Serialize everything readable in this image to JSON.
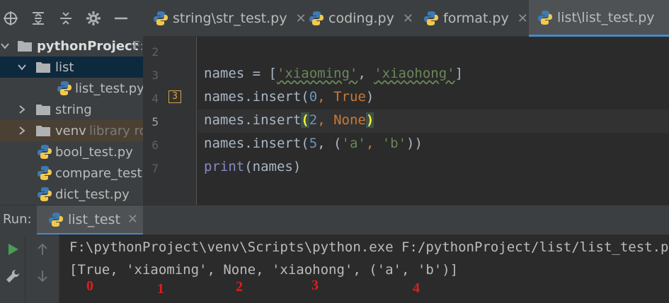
{
  "colors": {
    "accent": "#4a88c7",
    "annotation_red": "#e01e1e",
    "string_green": "#6a8759",
    "keyword_orange": "#cc7832"
  },
  "project_panel": {
    "toolbar_icons": [
      "locate-icon",
      "expand-all-icon",
      "collapse-all-icon",
      "gear-icon",
      "minimize-icon"
    ],
    "tree": [
      {
        "label": "pythonProject",
        "suffix": "F:",
        "kind": "folder",
        "expanded": true
      },
      {
        "label": "list",
        "kind": "folder",
        "expanded": true,
        "selected": true
      },
      {
        "label": "list_test.py",
        "kind": "python-file"
      },
      {
        "label": "string",
        "kind": "folder",
        "expanded": false
      },
      {
        "label": "venv",
        "suffix": "library ro",
        "kind": "folder",
        "expanded": false
      },
      {
        "label": "bool_test.py",
        "kind": "python-file"
      },
      {
        "label": "compare_test.p",
        "kind": "python-file"
      },
      {
        "label": "dict_test.py",
        "kind": "python-file"
      }
    ]
  },
  "editor_tabs": [
    {
      "label": "string\\str_test.py"
    },
    {
      "label": "coding.py"
    },
    {
      "label": "format.py"
    },
    {
      "label": "list\\list_test.py",
      "active": true
    }
  ],
  "editor": {
    "line_numbers": [
      "2",
      "3",
      "4",
      "5",
      "6",
      "7"
    ],
    "current_line": "5",
    "gutter_badge": "3",
    "code": {
      "l3": {
        "a": "names = [",
        "s1": "'xiaoming'",
        "b": ", ",
        "s2": "'xiaohong'",
        "c": "]"
      },
      "l4": {
        "a": "names.insert(",
        "n": "0",
        "b": ", ",
        "k": "True",
        "c": ")"
      },
      "l5": {
        "a": "names.insert",
        "p1": "(",
        "n": "2",
        "b": ", ",
        "k": "None",
        "p2": ")"
      },
      "l6": {
        "a": "names.insert(",
        "n": "5",
        "b": ", (",
        "s1": "'a'",
        "c": ", ",
        "s2": "'b'",
        "d": "))"
      },
      "l7": {
        "f": "print",
        "a": "(names)"
      }
    }
  },
  "run": {
    "title": "Run:",
    "tab_label": "list_test",
    "console_lines": [
      "F:\\pythonProject\\venv\\Scripts\\python.exe F:/pythonProject/list/list_test.py",
      "[True, 'xiaoming', None, 'xiaohong', ('a', 'b')]"
    ],
    "annotations": [
      "0",
      "1",
      "2",
      "3",
      "4"
    ]
  }
}
